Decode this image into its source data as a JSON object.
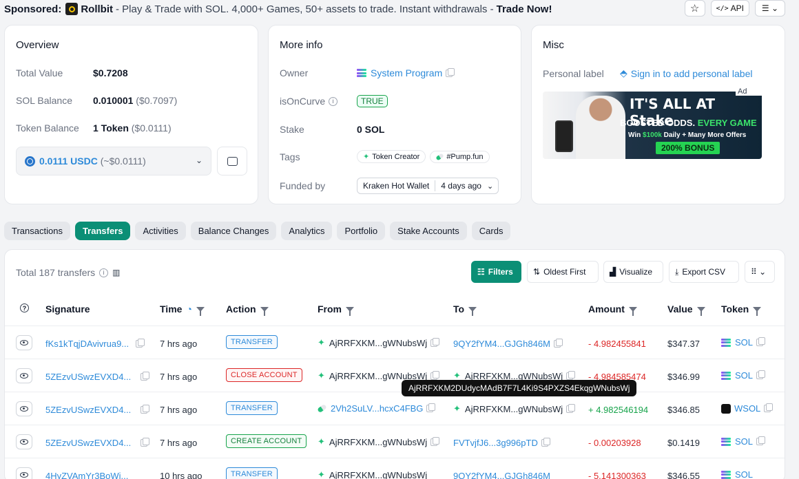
{
  "sponsor": {
    "label": "Sponsored:",
    "brand": "Rollbit",
    "text": " - Play & Trade with SOL. 4,000+ Games, 50+ assets to trade. Instant withdrawals - ",
    "cta": "Trade Now!"
  },
  "top_buttons": {
    "api": "API"
  },
  "overview": {
    "title": "Overview",
    "total_value_label": "Total Value",
    "total_value": "$0.7208",
    "sol_balance_label": "SOL Balance",
    "sol_balance": "0.010001",
    "sol_balance_usd": "($0.7097)",
    "token_balance_label": "Token Balance",
    "token_balance": "1 Token",
    "token_balance_usd": "($0.0111)",
    "usdc_select": "0.0111 USDC",
    "usdc_select_usd": "(~$0.0111)"
  },
  "more_info": {
    "title": "More info",
    "owner_label": "Owner",
    "owner": "System Program",
    "oncurve_label": "isOnCurve",
    "oncurve": "TRUE",
    "stake_label": "Stake",
    "stake": "0 SOL",
    "tags_label": "Tags",
    "tags": [
      "Token Creator",
      "#Pump.fun"
    ],
    "funded_label": "Funded by",
    "funded_by": "Kraken Hot Wallet",
    "funded_when": "4 days ago"
  },
  "misc": {
    "title": "Misc",
    "personal_label": "Personal label",
    "signin_link": "Sign in to add personal label",
    "ad": {
      "tag": "Ad",
      "line1": "IT'S ALL AT Stake",
      "line2a": "BOOSTED ODDS.",
      "line2b": " EVERY GAME",
      "line3a": "Win ",
      "line3b": "$100k",
      "line3c": " Daily + Many More Offers",
      "button": "200% BONUS"
    }
  },
  "tabs": [
    "Transactions",
    "Transfers",
    "Activities",
    "Balance Changes",
    "Analytics",
    "Portfolio",
    "Stake Accounts",
    "Cards"
  ],
  "table": {
    "total": "Total 187 transfers",
    "filters": "Filters",
    "oldest": "Oldest First",
    "visualize": "Visualize",
    "export": "Export CSV",
    "headers": [
      "Signature",
      "Time",
      "Action",
      "From",
      "To",
      "Amount",
      "Value",
      "Token"
    ],
    "rows": [
      {
        "sig": "fKs1kTqjDAvivrua9...",
        "time": "7 hrs ago",
        "action": "TRANSFER",
        "from": "AjRRFXKM...gWNubsWj",
        "to": "9QY2fYM4...GJGh846M",
        "amount": "- 4.982455841",
        "value": "$347.37",
        "token": "SOL"
      },
      {
        "sig": "5ZEzvUSwzEVXD4...",
        "time": "7 hrs ago",
        "action": "CLOSE ACCOUNT",
        "from": "AjRRFXKM...gWNubsWj",
        "to": "AjRRFXKM...gWNubsWj",
        "amount": "- 4.984585474",
        "value": "$346.99",
        "token": "SOL"
      },
      {
        "sig": "5ZEzvUSwzEVXD4...",
        "time": "7 hrs ago",
        "action": "TRANSFER",
        "from": "2Vh2SuLV...hcxC4FBG",
        "to": "AjRRFXKM...gWNubsWj",
        "amount": "+ 4.982546194",
        "value": "$346.85",
        "token": "WSOL"
      },
      {
        "sig": "5ZEzvUSwzEVXD4...",
        "time": "7 hrs ago",
        "action": "CREATE ACCOUNT",
        "from": "AjRRFXKM...gWNubsWj",
        "to": "FVTvjfJ6...3g996pTD",
        "amount": "- 0.00203928",
        "value": "$0.1419",
        "token": "SOL"
      },
      {
        "sig": "4HyZVAmYr3BoWi...",
        "time": "10 hrs ago",
        "action": "TRANSFER",
        "from": "AjRRFXKM...gWNubsWj",
        "to": "9QY2fYM4...GJGh846M",
        "amount": "- 5.141300363",
        "value": "$346.55",
        "token": "SOL"
      }
    ],
    "tooltip": "AjRRFXKM2DUdycMAdB7F7L4Ki9S4PXZS4EkqgWNubsWj"
  },
  "colors": {
    "accent": "#0b8f76",
    "link": "#2d8ad9",
    "negative": "#dc2626",
    "positive": "#16a34a"
  }
}
